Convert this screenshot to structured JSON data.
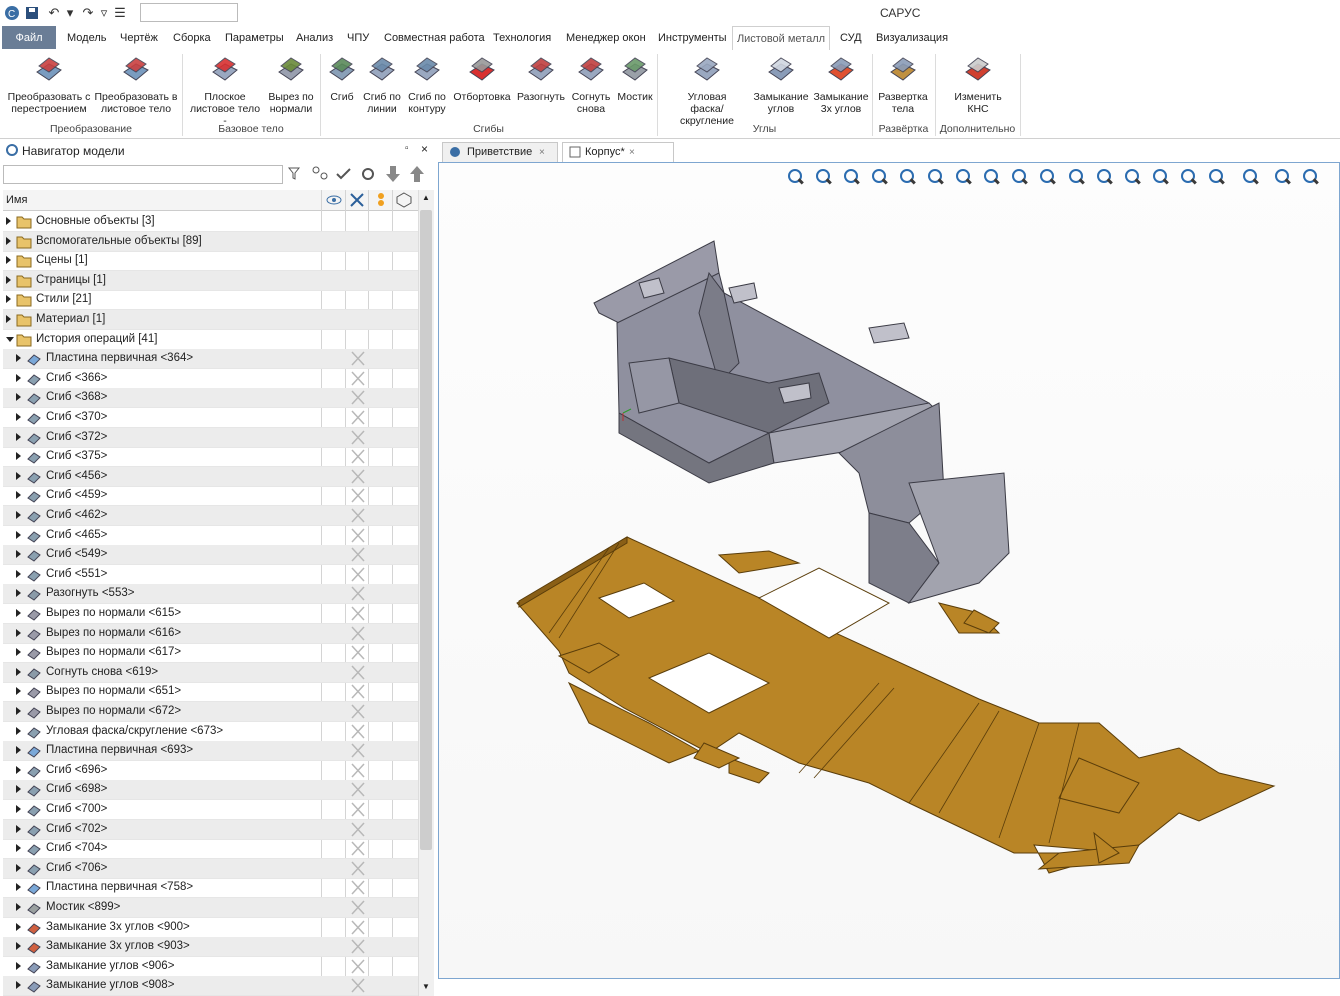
{
  "app": {
    "title": "САРУС"
  },
  "menu": {
    "tabs": [
      {
        "label": "Файл"
      },
      {
        "label": "Модель"
      },
      {
        "label": "Чертёж"
      },
      {
        "label": "Сборка"
      },
      {
        "label": "Параметры"
      },
      {
        "label": "Анализ"
      },
      {
        "label": "ЧПУ"
      },
      {
        "label": "Совместная работа"
      },
      {
        "label": "Технология"
      },
      {
        "label": "Менеджер окон"
      },
      {
        "label": "Инструменты"
      },
      {
        "label": "Листовой металл"
      },
      {
        "label": "СУД"
      },
      {
        "label": "Визуализация"
      }
    ],
    "active_tab": "Листовой металл"
  },
  "ribbon": {
    "buttons": [
      {
        "l1": "Преобразовать с",
        "l2": "перестроением",
        "icon": "convert-rebuild-icon"
      },
      {
        "l1": "Преобразовать в",
        "l2": "листовое тело",
        "icon": "convert-sheet-icon"
      },
      {
        "l1": "Плоское",
        "l2": "листовое тело -",
        "icon": "flat-sheet-body-icon"
      },
      {
        "l1": "Вырез по",
        "l2": "нормали",
        "icon": "normal-cut-icon"
      },
      {
        "l1": "Сгиб",
        "l2": "",
        "icon": "bend-icon"
      },
      {
        "l1": "Сгиб по",
        "l2": "линии",
        "icon": "bend-line-icon"
      },
      {
        "l1": "Сгиб по",
        "l2": "контуру",
        "icon": "bend-contour-icon"
      },
      {
        "l1": "Отбортовка",
        "l2": "",
        "icon": "flange-icon"
      },
      {
        "l1": "Разогнуть",
        "l2": "",
        "icon": "unbend-icon"
      },
      {
        "l1": "Согнуть",
        "l2": "снова",
        "icon": "rebend-icon"
      },
      {
        "l1": "Мостик",
        "l2": "",
        "icon": "bridge-icon"
      },
      {
        "l1": "Угловая",
        "l2": "фаска/скругление",
        "icon": "corner-chamfer-icon"
      },
      {
        "l1": "Замыкание",
        "l2": "углов",
        "icon": "corner-close-icon"
      },
      {
        "l1": "Замыкание",
        "l2": "3х углов",
        "icon": "three-corner-close-icon"
      },
      {
        "l1": "Развертка",
        "l2": "тела",
        "icon": "body-unfold-icon"
      },
      {
        "l1": "Изменить",
        "l2": "КНС",
        "icon": "change-cs-icon"
      }
    ],
    "groups": [
      "Преобразование",
      "Базовое тело",
      "Сгибы",
      "Углы",
      "Развёртка",
      "Дополнительно"
    ]
  },
  "navigator": {
    "title": "Навигатор модели",
    "search_value": "",
    "column_name": "Имя",
    "items": [
      {
        "label": "Основные объекты [3]",
        "icon": "folder-icon",
        "level": 0
      },
      {
        "label": "Вспомогательные объекты [89]",
        "icon": "folder-aux-icon",
        "level": 0
      },
      {
        "label": "Сцены [1]",
        "icon": "folder-scenes-icon",
        "level": 0
      },
      {
        "label": "Страницы [1]",
        "icon": "folder-pages-icon",
        "level": 0
      },
      {
        "label": "Стили [21]",
        "icon": "folder-styles-icon",
        "level": 0
      },
      {
        "label": "Материал [1]",
        "icon": "folder-material-icon",
        "level": 0
      },
      {
        "label": "История операций [41]",
        "icon": "folder-history-icon",
        "level": 0,
        "expanded": true
      },
      {
        "label": "Пластина первичная <364>",
        "icon": "plate-icon",
        "level": 1
      },
      {
        "label": "Сгиб <366>",
        "icon": "bend-icon",
        "level": 1
      },
      {
        "label": "Сгиб <368>",
        "icon": "bend-icon",
        "level": 1
      },
      {
        "label": "Сгиб <370>",
        "icon": "bend-icon",
        "level": 1
      },
      {
        "label": "Сгиб <372>",
        "icon": "bend-icon",
        "level": 1
      },
      {
        "label": "Сгиб <375>",
        "icon": "bend-icon",
        "level": 1
      },
      {
        "label": "Сгиб <456>",
        "icon": "bend-icon",
        "level": 1
      },
      {
        "label": "Сгиб <459>",
        "icon": "bend-icon",
        "level": 1
      },
      {
        "label": "Сгиб <462>",
        "icon": "bend-icon",
        "level": 1
      },
      {
        "label": "Сгиб <465>",
        "icon": "bend-icon",
        "level": 1
      },
      {
        "label": "Сгиб <549>",
        "icon": "bend-icon",
        "level": 1
      },
      {
        "label": "Сгиб <551>",
        "icon": "bend-icon",
        "level": 1
      },
      {
        "label": "Разогнуть <553>",
        "icon": "unbend-icon",
        "level": 1
      },
      {
        "label": "Вырез по нормали <615>",
        "icon": "normal-cut-icon",
        "level": 1
      },
      {
        "label": "Вырез по нормали <616>",
        "icon": "normal-cut-icon",
        "level": 1
      },
      {
        "label": "Вырез по нормали <617>",
        "icon": "normal-cut-icon",
        "level": 1
      },
      {
        "label": "Согнуть снова <619>",
        "icon": "rebend-icon",
        "level": 1
      },
      {
        "label": "Вырез по нормали <651>",
        "icon": "normal-cut-icon",
        "level": 1
      },
      {
        "label": "Вырез по нормали <672>",
        "icon": "normal-cut-icon",
        "level": 1
      },
      {
        "label": "Угловая фаска/скругление <673>",
        "icon": "corner-chamfer-icon",
        "level": 1
      },
      {
        "label": "Пластина первичная <693>",
        "icon": "plate-icon",
        "level": 1
      },
      {
        "label": "Сгиб <696>",
        "icon": "bend-icon",
        "level": 1
      },
      {
        "label": "Сгиб <698>",
        "icon": "bend-icon",
        "level": 1
      },
      {
        "label": "Сгиб <700>",
        "icon": "bend-icon",
        "level": 1
      },
      {
        "label": "Сгиб <702>",
        "icon": "bend-icon",
        "level": 1
      },
      {
        "label": "Сгиб <704>",
        "icon": "bend-icon",
        "level": 1
      },
      {
        "label": "Сгиб <706>",
        "icon": "bend-icon",
        "level": 1
      },
      {
        "label": "Пластина первичная <758>",
        "icon": "plate-icon",
        "level": 1
      },
      {
        "label": "Мостик <899>",
        "icon": "bridge-icon",
        "level": 1
      },
      {
        "label": "Замыкание 3х углов <900>",
        "icon": "three-corner-close-icon",
        "level": 1
      },
      {
        "label": "Замыкание 3х углов <903>",
        "icon": "three-corner-close-icon",
        "level": 1
      },
      {
        "label": "Замыкание углов <906>",
        "icon": "corner-close-icon",
        "level": 1
      },
      {
        "label": "Замыкание углов <908>",
        "icon": "corner-close-icon",
        "level": 1
      }
    ]
  },
  "documents": {
    "tabs": [
      {
        "label": "Приветствие",
        "icon": "welcome-icon"
      },
      {
        "label": "Корпус*",
        "icon": "part-icon",
        "active": true
      }
    ]
  },
  "colors": {
    "file_tab": "#6a7d96",
    "model_gray": "#8f909f",
    "unfold_orange": "#b98526",
    "viewport_border": "#7ea6d0"
  }
}
